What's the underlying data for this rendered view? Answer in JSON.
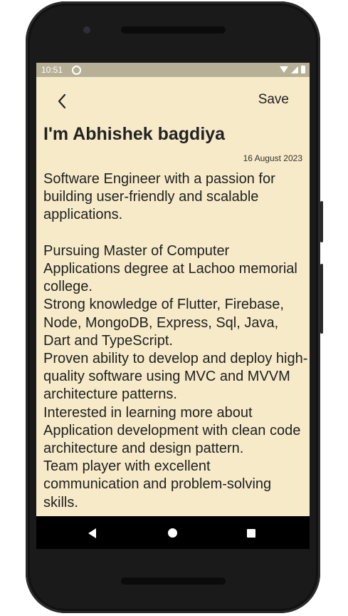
{
  "status": {
    "time": "10:51",
    "icons": [
      "sync-icon",
      "wifi-icon",
      "signal-icon",
      "battery-icon"
    ]
  },
  "toolbar": {
    "back_icon": "chevron-left-icon",
    "save_label": "Save"
  },
  "note": {
    "title": "I'm Abhishek bagdiya",
    "date": "16 August 2023",
    "body": "Software Engineer with a passion for building user-friendly and scalable applications.\n\nPursuing Master of Computer Applications degree at Lachoo memorial college.\nStrong knowledge of Flutter, Firebase, Node, MongoDB, Express, Sql, Java, Dart and TypeScript.\nProven ability to develop and deploy high-quality software using MVC and MVVM architecture patterns.\nInterested in learning more about Application development with clean code architecture and design pattern.\nTeam player with excellent communication and problem-solving skills."
  },
  "navigation": {
    "icons": [
      "nav-back-icon",
      "nav-home-icon",
      "nav-recents-icon"
    ]
  },
  "colors": {
    "background": "#f6eac8",
    "statusbar": "#b7b096",
    "text": "#1f1f1f"
  }
}
